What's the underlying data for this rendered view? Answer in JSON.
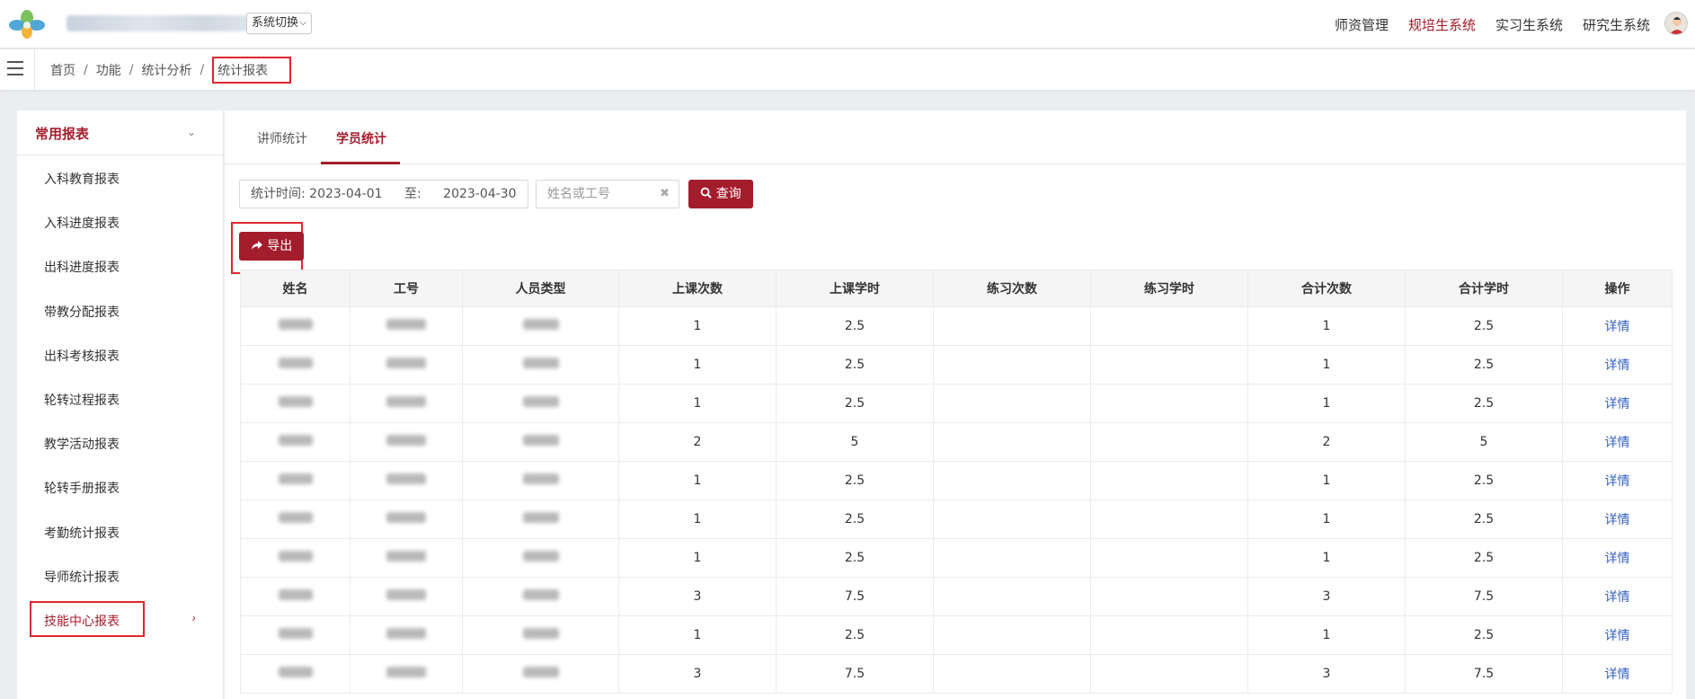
{
  "header": {
    "system_switch": "系统切换",
    "nav": [
      "师资管理",
      "规培生系统",
      "实习生系统",
      "研究生系统"
    ],
    "active_nav_index": 1
  },
  "breadcrumb": {
    "items": [
      "首页",
      "功能",
      "统计分析"
    ],
    "current": "统计报表"
  },
  "sidebar": {
    "title": "常用报表",
    "items": [
      {
        "label": "入科教育报表"
      },
      {
        "label": "入科进度报表"
      },
      {
        "label": "出科进度报表"
      },
      {
        "label": "带教分配报表"
      },
      {
        "label": "出科考核报表"
      },
      {
        "label": "轮转过程报表"
      },
      {
        "label": "教学活动报表"
      },
      {
        "label": "轮转手册报表"
      },
      {
        "label": "考勤统计报表"
      },
      {
        "label": "导师统计报表"
      },
      {
        "label": "技能中心报表"
      }
    ]
  },
  "tabs": [
    "讲师统计",
    "学员统计"
  ],
  "active_tab_index": 1,
  "filters": {
    "date_label": "统计时间:",
    "start_date": "2023-04-01",
    "to_label": "至:",
    "end_date": "2023-04-30",
    "search_placeholder": "姓名或工号",
    "query_label": "查询",
    "export_label": "导出"
  },
  "table": {
    "columns": [
      "姓名",
      "工号",
      "人员类型",
      "上课次数",
      "上课学时",
      "练习次数",
      "练习学时",
      "合计次数",
      "合计学时",
      "操作"
    ],
    "rows": [
      {
        "classes": "1",
        "hours": "2.5",
        "total_count": "1",
        "total_hours": "2.5",
        "action": "详情"
      },
      {
        "classes": "1",
        "hours": "2.5",
        "total_count": "1",
        "total_hours": "2.5",
        "action": "详情"
      },
      {
        "classes": "1",
        "hours": "2.5",
        "total_count": "1",
        "total_hours": "2.5",
        "action": "详情"
      },
      {
        "classes": "2",
        "hours": "5",
        "total_count": "2",
        "total_hours": "5",
        "action": "详情"
      },
      {
        "classes": "1",
        "hours": "2.5",
        "total_count": "1",
        "total_hours": "2.5",
        "action": "详情"
      },
      {
        "classes": "1",
        "hours": "2.5",
        "total_count": "1",
        "total_hours": "2.5",
        "action": "详情"
      },
      {
        "classes": "1",
        "hours": "2.5",
        "total_count": "1",
        "total_hours": "2.5",
        "action": "详情"
      },
      {
        "classes": "3",
        "hours": "7.5",
        "total_count": "3",
        "total_hours": "7.5",
        "action": "详情"
      },
      {
        "classes": "1",
        "hours": "2.5",
        "total_count": "1",
        "total_hours": "2.5",
        "action": "详情"
      },
      {
        "classes": "3",
        "hours": "7.5",
        "total_count": "3",
        "total_hours": "7.5",
        "action": "详情"
      }
    ]
  },
  "colors": {
    "brand": "#a31d2c",
    "highlight_box": "#e0262f",
    "link": "#3360c0"
  },
  "icons": {
    "logo": "flower-logo-icon",
    "menu": "hamburger-menu-icon",
    "query": "search-icon",
    "export": "share-arrow-icon",
    "clear": "close-icon",
    "avatar": "user-avatar"
  }
}
